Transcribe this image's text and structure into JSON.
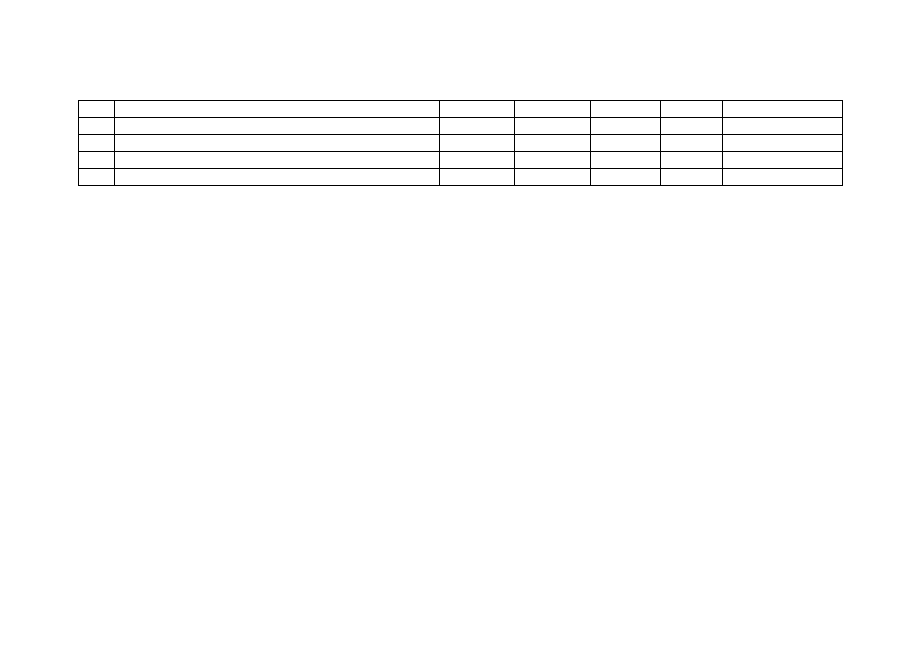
{
  "table": {
    "rows": [
      {
        "c1": "",
        "c2": "",
        "c3": "",
        "c4": "",
        "c5": "",
        "c6": "",
        "c7": ""
      },
      {
        "c1": "",
        "c2": "",
        "c3": "",
        "c4": "",
        "c5": "",
        "c6": "",
        "c7": ""
      },
      {
        "c1": "",
        "c2": "",
        "c3": "",
        "c4": "",
        "c5": "",
        "c6": "",
        "c7": ""
      },
      {
        "c1": "",
        "c2": "",
        "c3": "",
        "c4": "",
        "c5": "",
        "c6": "",
        "c7": ""
      },
      {
        "c1": "",
        "c2": "",
        "c3": "",
        "c4": "",
        "c5": "",
        "c6": "",
        "c7": ""
      }
    ]
  }
}
